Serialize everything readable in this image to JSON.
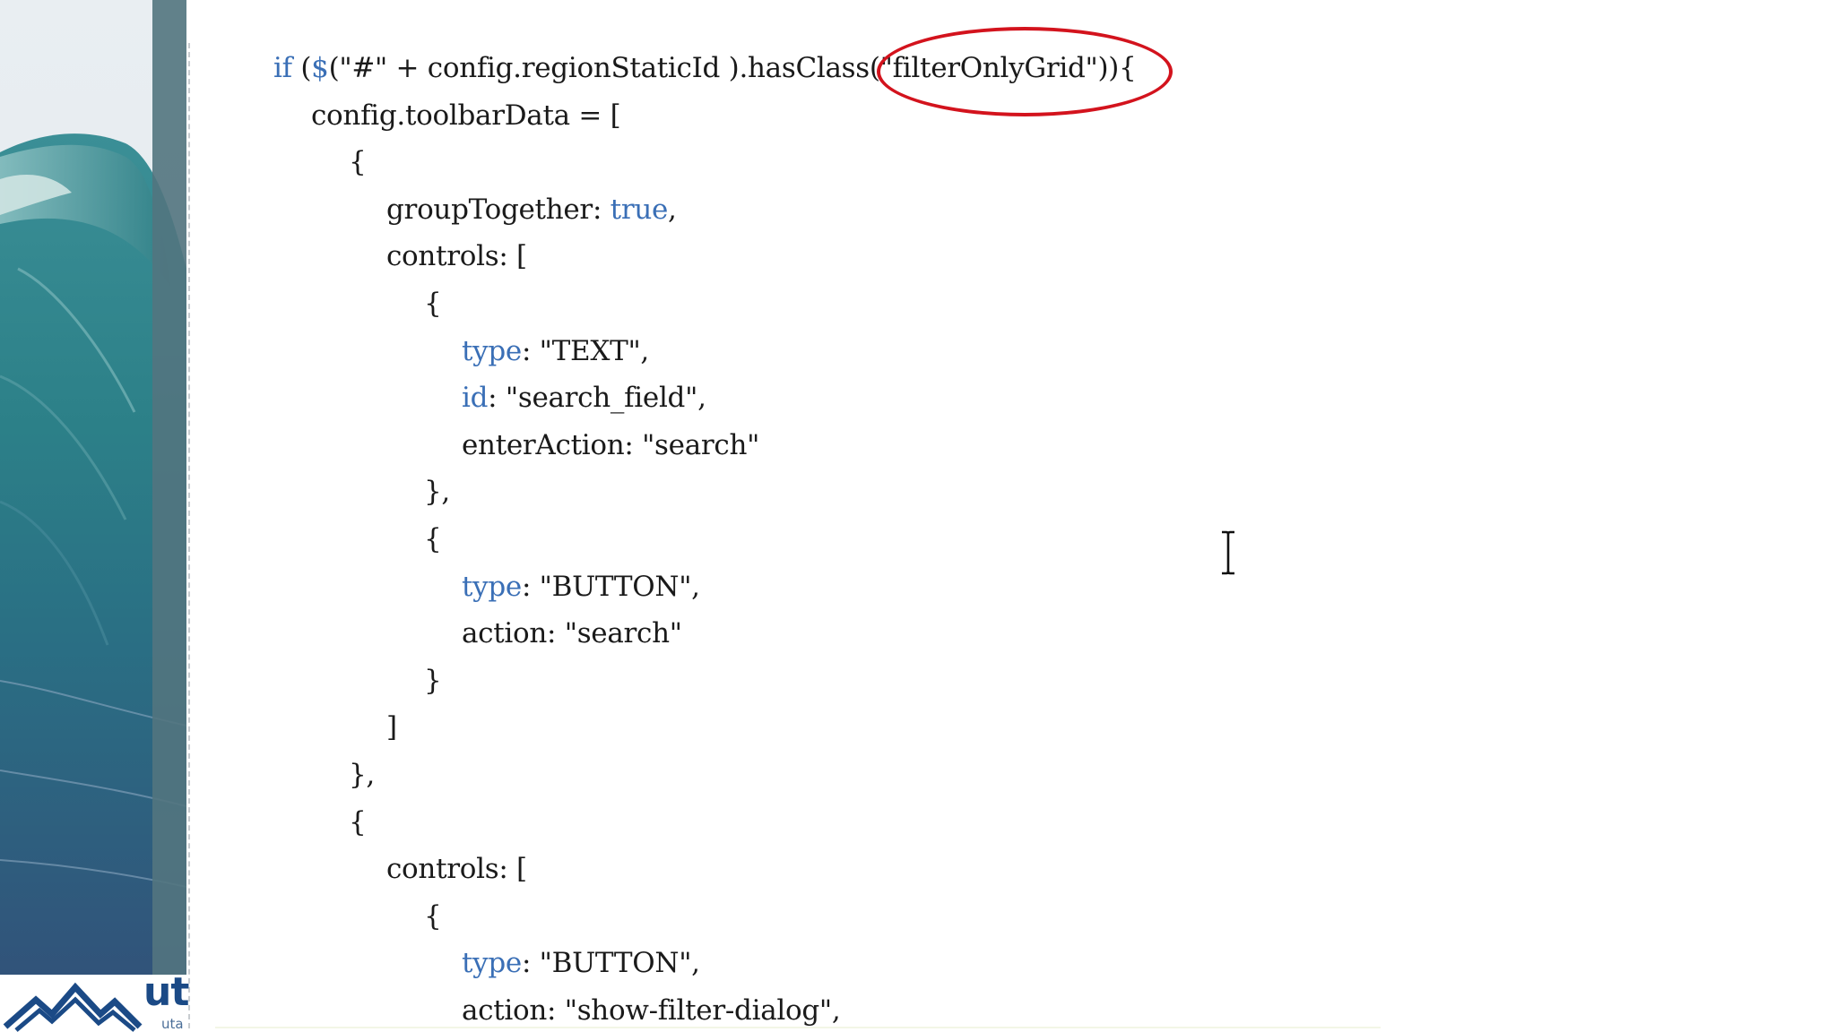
{
  "code_lines": [
    {
      "id": "l01",
      "indent": 0,
      "parts": [
        {
          "kw": true,
          "text": "if"
        },
        {
          "kw": false,
          "text": " ("
        },
        {
          "kw": true,
          "text": "$"
        },
        {
          "kw": false,
          "text": "(\"#\" + config.regionStaticId ).hasClass(\"filterOnlyGrid\")){"
        }
      ]
    },
    {
      "id": "l02",
      "indent": 1,
      "parts": [
        {
          "kw": false,
          "text": "config.toolbarData = ["
        }
      ]
    },
    {
      "id": "l03",
      "indent": 2,
      "parts": [
        {
          "kw": false,
          "text": "{"
        }
      ]
    },
    {
      "id": "l04",
      "indent": 3,
      "parts": [
        {
          "kw": false,
          "text": "groupTogether: "
        },
        {
          "kw": true,
          "text": "true"
        },
        {
          "kw": false,
          "text": ","
        }
      ]
    },
    {
      "id": "l05",
      "indent": 3,
      "parts": [
        {
          "kw": false,
          "text": "controls: ["
        }
      ]
    },
    {
      "id": "l06",
      "indent": 4,
      "parts": [
        {
          "kw": false,
          "text": "{"
        }
      ]
    },
    {
      "id": "l07",
      "indent": 5,
      "parts": [
        {
          "kw": true,
          "text": "type"
        },
        {
          "kw": false,
          "text": ": \"TEXT\","
        }
      ]
    },
    {
      "id": "l08",
      "indent": 5,
      "parts": [
        {
          "kw": true,
          "text": "id"
        },
        {
          "kw": false,
          "text": ": \"search_field\","
        }
      ]
    },
    {
      "id": "l09",
      "indent": 5,
      "parts": [
        {
          "kw": false,
          "text": "enterAction: \"search\""
        }
      ]
    },
    {
      "id": "l10",
      "indent": 4,
      "parts": [
        {
          "kw": false,
          "text": "},"
        }
      ]
    },
    {
      "id": "l11",
      "indent": 4,
      "parts": [
        {
          "kw": false,
          "text": "{"
        }
      ]
    },
    {
      "id": "l12",
      "indent": 5,
      "parts": [
        {
          "kw": true,
          "text": "type"
        },
        {
          "kw": false,
          "text": ": \"BUTTON\","
        }
      ]
    },
    {
      "id": "l13",
      "indent": 5,
      "parts": [
        {
          "kw": false,
          "text": "action: \"search\""
        }
      ]
    },
    {
      "id": "l14",
      "indent": 4,
      "parts": [
        {
          "kw": false,
          "text": "}"
        }
      ]
    },
    {
      "id": "l15",
      "indent": 3,
      "parts": [
        {
          "kw": false,
          "text": "]"
        }
      ]
    },
    {
      "id": "l16",
      "indent": 2,
      "parts": [
        {
          "kw": false,
          "text": "},"
        }
      ]
    },
    {
      "id": "l17",
      "indent": 2,
      "parts": [
        {
          "kw": false,
          "text": "{"
        }
      ]
    },
    {
      "id": "l18",
      "indent": 3,
      "parts": [
        {
          "kw": false,
          "text": "controls: ["
        }
      ]
    },
    {
      "id": "l19",
      "indent": 4,
      "parts": [
        {
          "kw": false,
          "text": "{"
        }
      ]
    },
    {
      "id": "l20",
      "indent": 5,
      "parts": [
        {
          "kw": true,
          "text": "type"
        },
        {
          "kw": false,
          "text": ": \"BUTTON\","
        }
      ]
    },
    {
      "id": "l21",
      "indent": 5,
      "parts": [
        {
          "kw": false,
          "text": "action: \"show-filter-dialog\","
        }
      ]
    }
  ],
  "logo": {
    "text": "ut",
    "subtext": "uta"
  },
  "colors": {
    "keyword": "#3a6fb6",
    "text": "#1a1a1a",
    "annotation": "#d3131d",
    "logo": "#1b4a86"
  },
  "icons": {
    "cursor": "text-ibeam-cursor",
    "logo_mark": "mountain-logo-icon"
  }
}
